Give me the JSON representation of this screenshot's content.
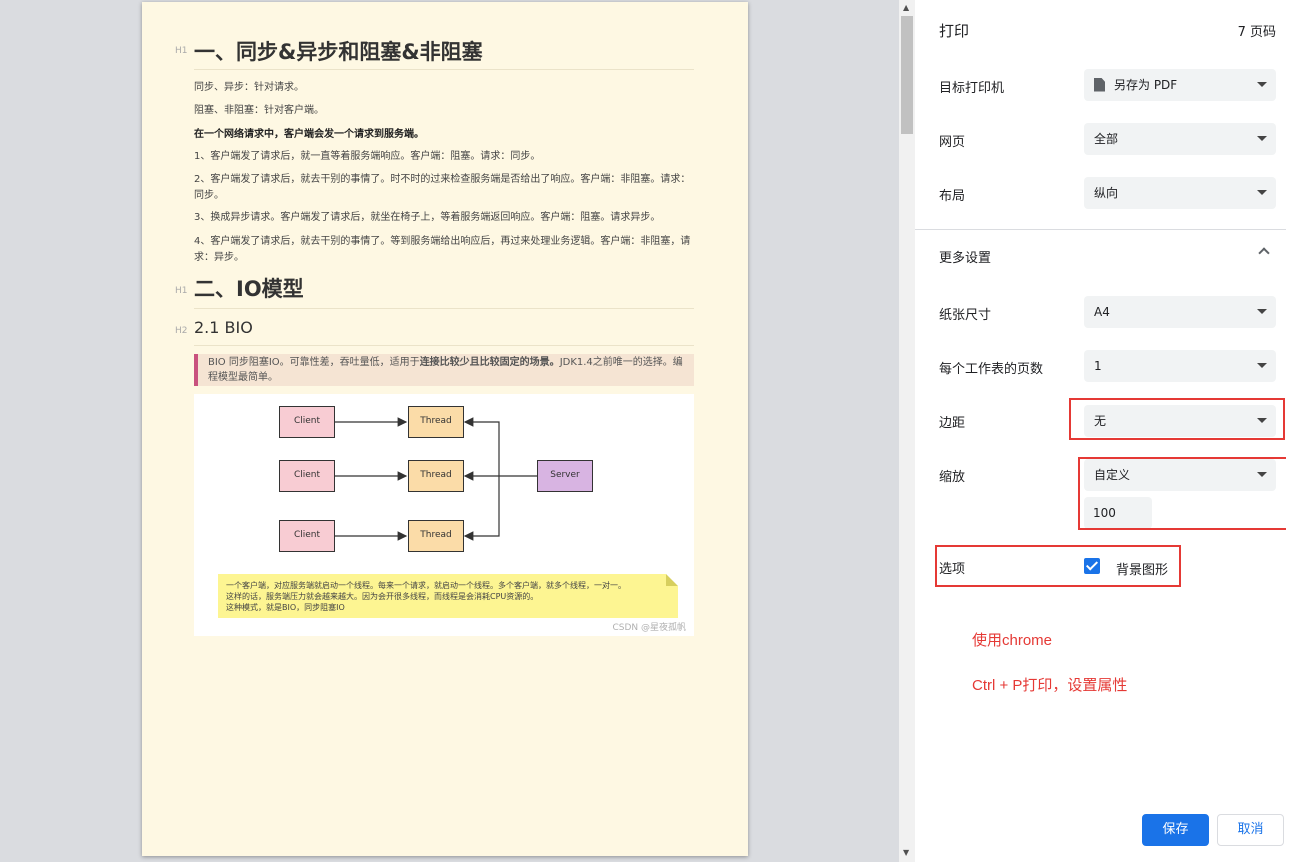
{
  "document": {
    "h1_marker": "H1",
    "h2_marker": "H2",
    "heading1": "一、同步&异步和阻塞&非阻塞",
    "para1": "同步、异步：针对请求。",
    "para2": "阻塞、非阻塞：针对客户端。",
    "para3": "在一个网络请求中，客户端会发一个请求到服务端。",
    "para4": "1、客户端发了请求后，就一直等着服务端响应。客户端：阻塞。请求：同步。",
    "para5": "2、客户端发了请求后，就去干别的事情了。时不时的过来检查服务端是否给出了响应。客户端：非阻塞。请求：同步。",
    "para6": "3、换成异步请求。客户端发了请求后，就坐在椅子上，等着服务端返回响应。客户端：阻塞。请求异步。",
    "para7": "4、客户端发了请求后，就去干别的事情了。等到服务端给出响应后，再过来处理业务逻辑。客户端：非阻塞，请求：异步。",
    "heading2": "二、IO模型",
    "subheading": "2.1 BIO",
    "quote_prefix": "BIO 同步阻塞IO。可靠性差，吞吐量低，适用于",
    "quote_bold": "连接比较少且比较固定的场景。",
    "quote_suffix": "JDK1.4之前唯一的选择。编程模型最简单。",
    "diagram": {
      "client": "Client",
      "thread": "Thread",
      "server": "Server",
      "note_line1": "一个客户端，对应服务端就启动一个线程。每来一个请求，就启动一个线程。多个客户端，就多个线程，一对一。",
      "note_line2": "这样的话，服务端压力就会越来越大。因为会开很多线程，而线程是会消耗CPU资源的。",
      "note_line3": "这种模式，就是BIO，同步阻塞IO",
      "watermark": "CSDN @星夜孤帆"
    }
  },
  "panel": {
    "title": "打印",
    "page_count": "7 页码",
    "destination_label": "目标打印机",
    "destination_value": "另存为 PDF",
    "pages_label": "网页",
    "pages_value": "全部",
    "layout_label": "布局",
    "layout_value": "纵向",
    "more_settings": "更多设置",
    "paper_label": "纸张尺寸",
    "paper_value": "A4",
    "pps_label": "每个工作表的页数",
    "pps_value": "1",
    "margins_label": "边距",
    "margins_value": "无",
    "scale_label": "缩放",
    "scale_value": "自定义",
    "scale_number": "100",
    "options_label": "选项",
    "bg_graphics_label": "背景图形",
    "annotation1": "使用chrome",
    "annotation2": "Ctrl + P打印，设置属性",
    "save_button": "保存",
    "cancel_button": "取消"
  },
  "colors": {
    "accent": "#1a73e8",
    "highlight_box": "#e53935",
    "page_background": "#fef8e3"
  }
}
